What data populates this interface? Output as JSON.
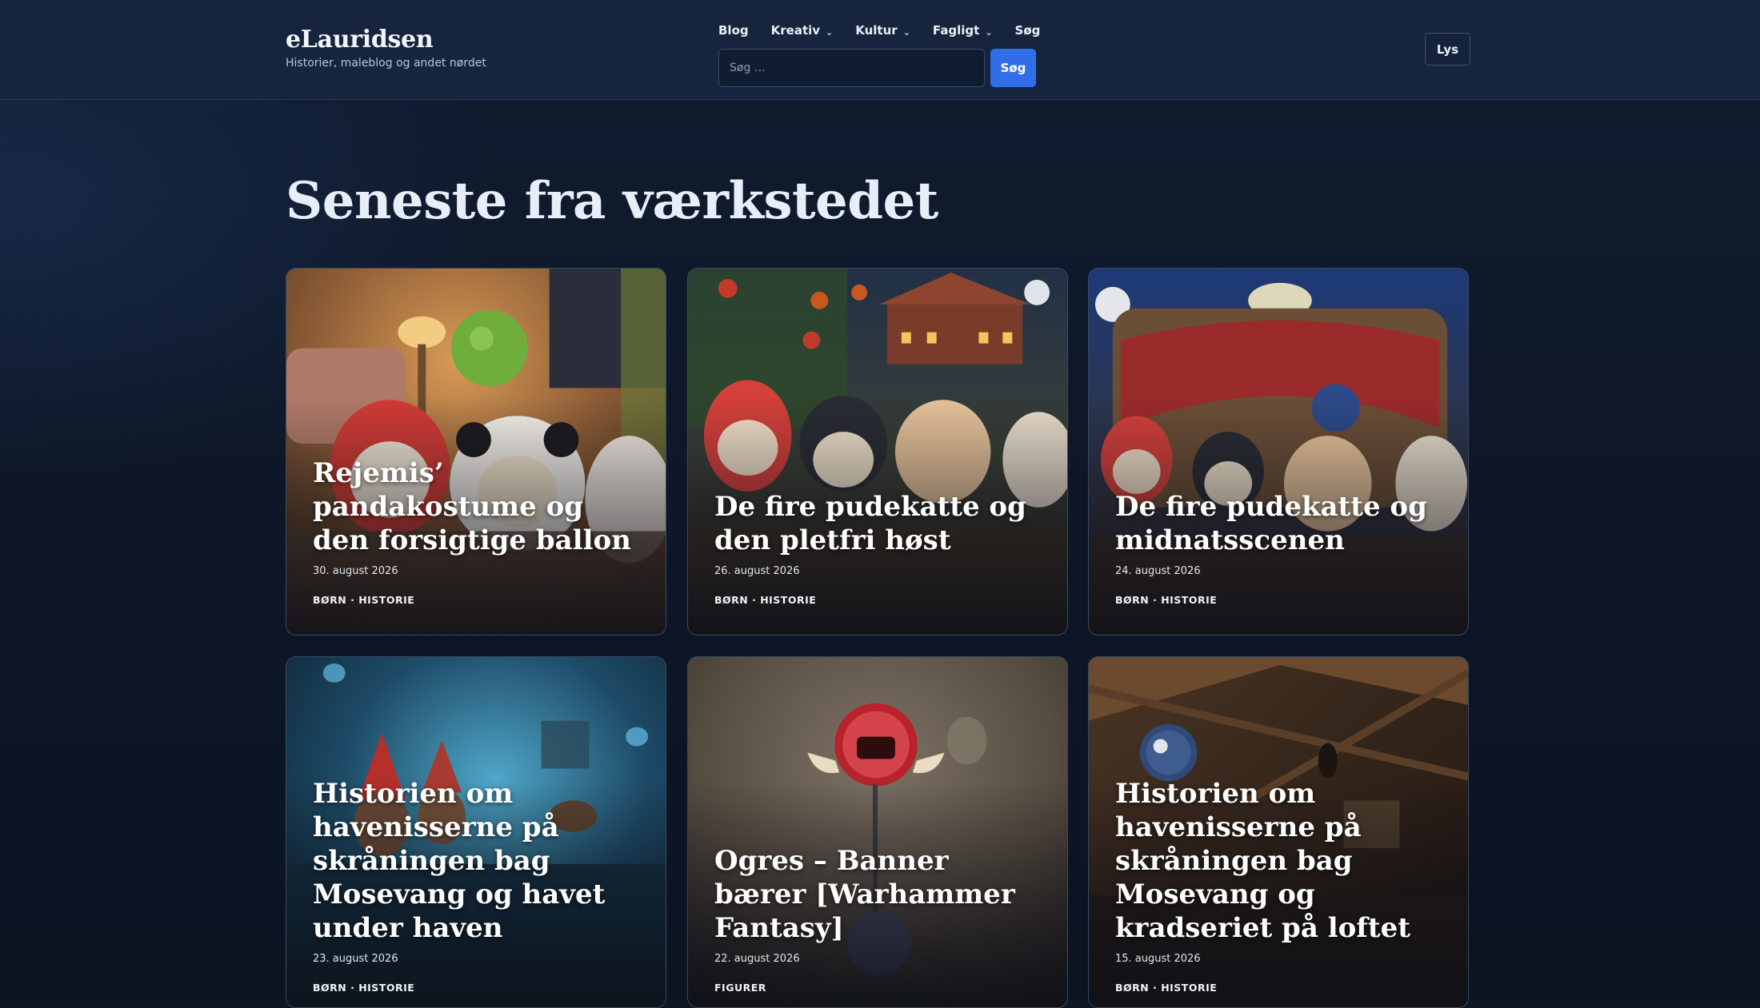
{
  "header": {
    "brand_title": "eLauridsen",
    "brand_tagline": "Historier, maleblog og andet nørdet",
    "nav": [
      {
        "label": "Blog",
        "has_dropdown": false
      },
      {
        "label": "Kreativ",
        "has_dropdown": true
      },
      {
        "label": "Kultur",
        "has_dropdown": true
      },
      {
        "label": "Fagligt",
        "has_dropdown": true
      },
      {
        "label": "Søg",
        "has_dropdown": false
      }
    ],
    "search_placeholder": "Søg …",
    "search_button": "Søg",
    "theme_toggle": "Lys"
  },
  "page_title": "Seneste fra værkstedet",
  "colors": {
    "header_bg": "#16253d",
    "page_bg": "#0e1726",
    "accent": "#2f6ee8"
  },
  "posts": [
    {
      "title": "Rejemis’ pandakostume og den forsigtige ballon",
      "date": "30. august 2026",
      "tags": "BØRN · HISTORIE",
      "art": "cats-living-room-balloon"
    },
    {
      "title": "De fire pudekatte og den pletfri høst",
      "date": "26. august 2026",
      "tags": "BØRN · HISTORIE",
      "art": "cats-orchard-night"
    },
    {
      "title": "De fire pudekatte og midnatsscenen",
      "date": "24. august 2026",
      "tags": "BØRN · HISTORIE",
      "art": "cats-tree-stage"
    },
    {
      "title": "Historien om havenisserne på skråningen bag Mosevang og havet under haven",
      "date": "23. august 2026",
      "tags": "BØRN · HISTORIE",
      "art": "gnomes-underwater-cave"
    },
    {
      "title": "Ogres – Banner bærer [Warhammer Fantasy]",
      "date": "22. august 2026",
      "tags": "FIGURER",
      "art": "ogre-banner-miniature"
    },
    {
      "title": "Historien om havenisserne på skråningen bag Mosevang og kradseriet på loftet",
      "date": "15. august 2026",
      "tags": "BØRN · HISTORIE",
      "art": "attic-moonlit"
    }
  ]
}
